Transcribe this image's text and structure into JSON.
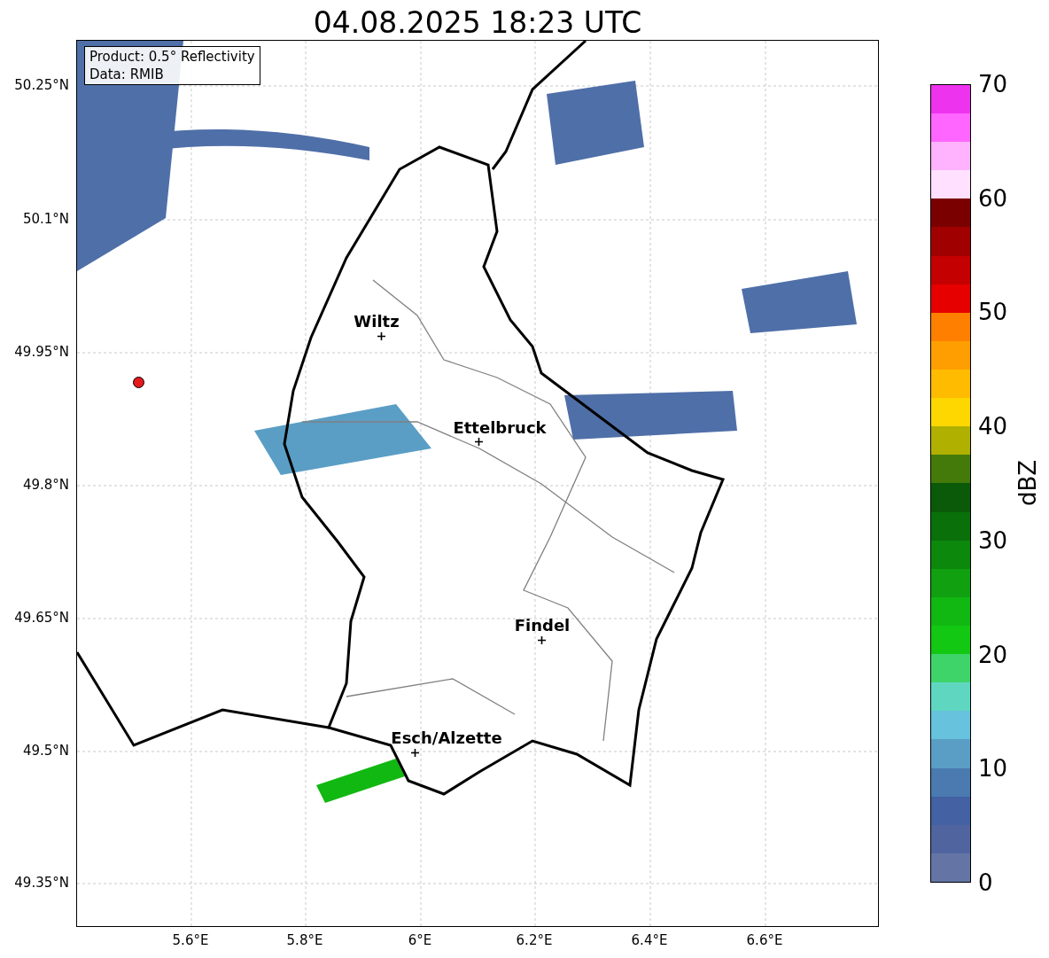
{
  "title": "04.08.2025 18:23 UTC",
  "info_box": {
    "lines": [
      "Product: 0.5° Reflectivity",
      "Data: RMIB"
    ]
  },
  "map": {
    "lat_ticks": [
      "50.25°N",
      "50.1°N",
      "49.95°N",
      "49.8°N",
      "49.65°N",
      "49.5°N",
      "49.35°N"
    ],
    "lon_ticks": [
      "5.6°E",
      "5.8°E",
      "6°E",
      "6.2°E",
      "6.4°E",
      "6.6°E"
    ],
    "cities": [
      {
        "name": "Wiltz"
      },
      {
        "name": "Ettelbruck"
      },
      {
        "name": "Findel"
      },
      {
        "name": "Esch/Alzette"
      }
    ]
  },
  "colorbar": {
    "label": "dBZ",
    "ticks": [
      "70",
      "60",
      "50",
      "40",
      "30",
      "20",
      "10",
      "0"
    ],
    "bins": [
      {
        "color": "#6475a5"
      },
      {
        "color": "#5065a0"
      },
      {
        "color": "#4361a3"
      },
      {
        "color": "#4a7ab0"
      },
      {
        "color": "#5a9ec5"
      },
      {
        "color": "#66c2dd"
      },
      {
        "color": "#5fd7c0"
      },
      {
        "color": "#3ed46a"
      },
      {
        "color": "#12c812"
      },
      {
        "color": "#12b812"
      },
      {
        "color": "#10a010"
      },
      {
        "color": "#0c880c"
      },
      {
        "color": "#0a700a"
      },
      {
        "color": "#0a5a0a"
      },
      {
        "color": "#447a0a"
      },
      {
        "color": "#b0b000"
      },
      {
        "color": "#ffd700"
      },
      {
        "color": "#ffbb00"
      },
      {
        "color": "#ff9e00"
      },
      {
        "color": "#ff8000"
      },
      {
        "color": "#e60000"
      },
      {
        "color": "#c40000"
      },
      {
        "color": "#a00000"
      },
      {
        "color": "#7a0000"
      },
      {
        "color": "#ffe0ff"
      },
      {
        "color": "#ffb3ff"
      },
      {
        "color": "#ff66ff"
      },
      {
        "color": "#ee33ee"
      }
    ]
  }
}
